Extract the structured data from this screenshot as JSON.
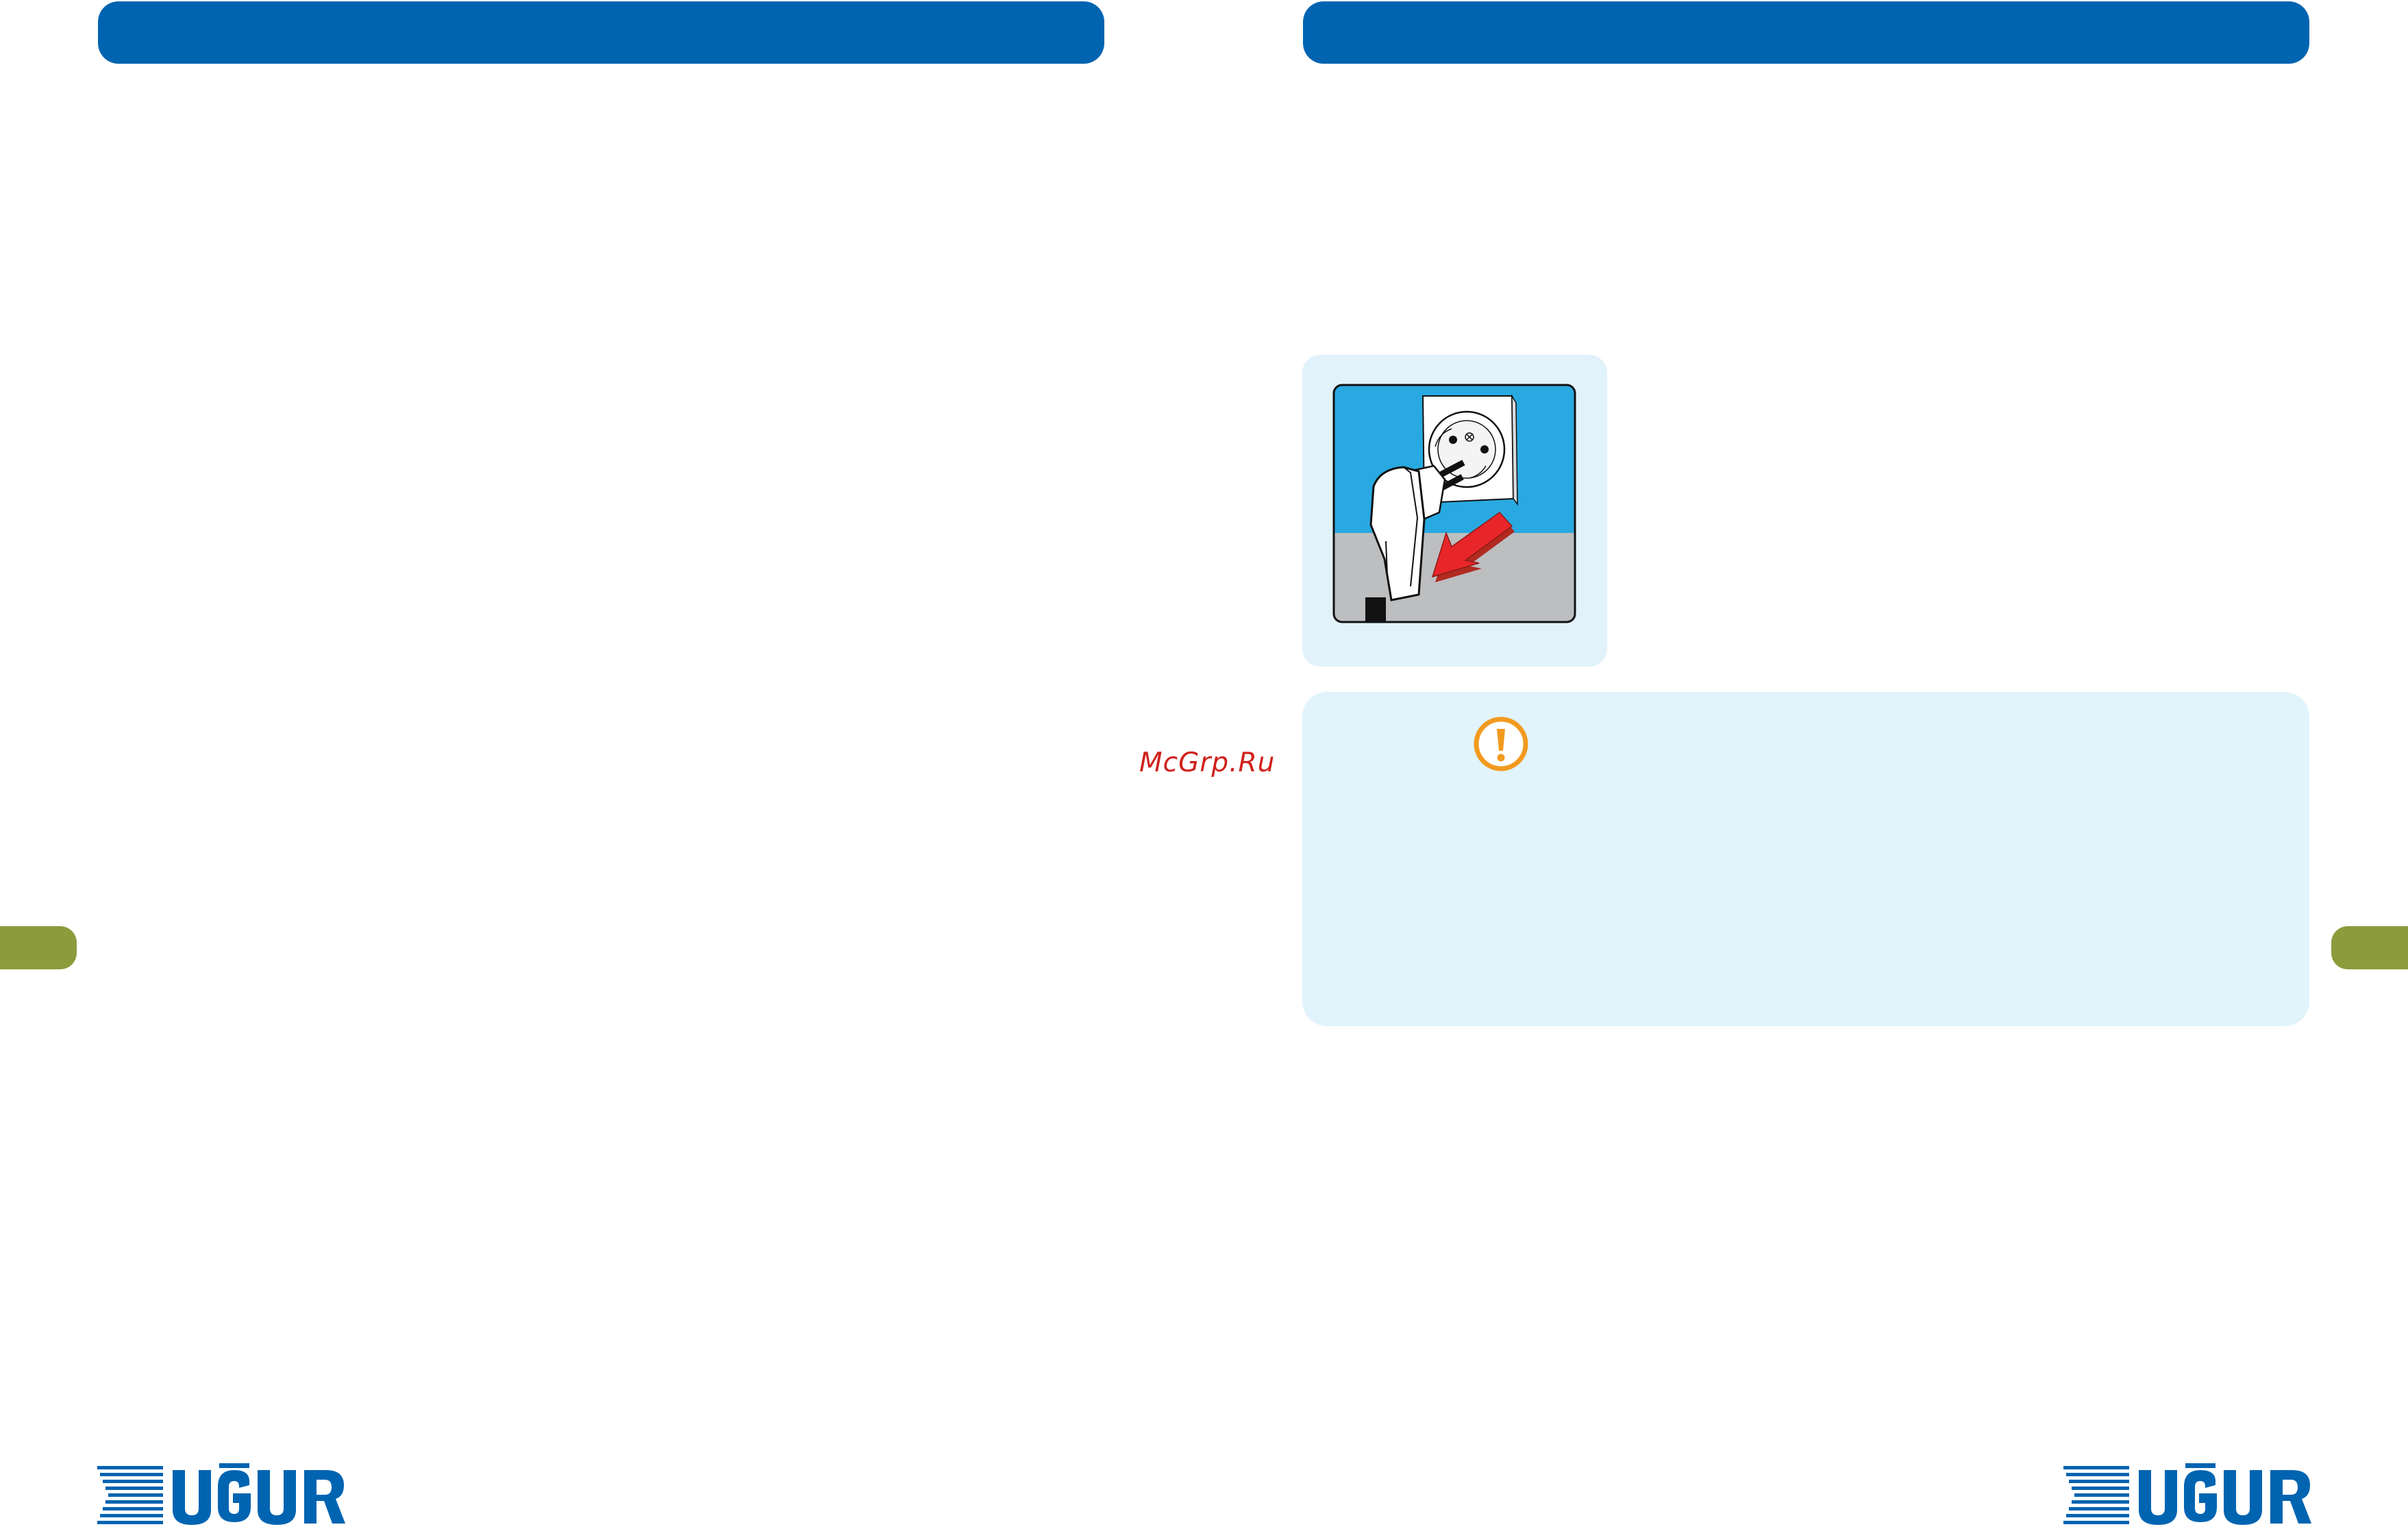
{
  "header": {
    "left_bar_color": "#0064b1",
    "right_bar_color": "#0064b1"
  },
  "side_tabs": {
    "color": "#8c9c3c"
  },
  "illustration": {
    "icon": "unplug-power-cord-icon",
    "background": "#e1f2fb"
  },
  "warning": {
    "icon": "exclamation-warning-icon",
    "icon_color": "#f29a1f",
    "background": "#e1f4fc"
  },
  "watermark": {
    "text": "McGrp.Ru"
  },
  "brand": {
    "name": "UĞUR",
    "color": "#0064b1"
  }
}
